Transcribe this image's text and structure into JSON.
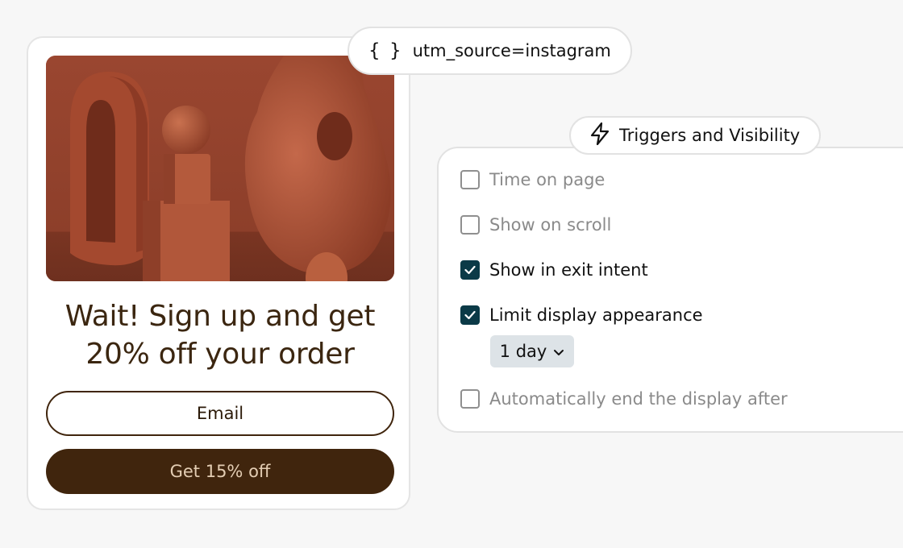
{
  "popup": {
    "headline": "Wait! Sign up and get 20% off your order",
    "email_placeholder": "Email",
    "cta_label": "Get 15% off"
  },
  "utm_chip": {
    "icon": "braces-icon",
    "label": "utm_source=instagram"
  },
  "triggers": {
    "title": "Triggers and Visibility",
    "icon": "lightning-icon",
    "options": [
      {
        "label": "Time on page",
        "checked": false
      },
      {
        "label": "Show on scroll",
        "checked": false
      },
      {
        "label": "Show in exit intent",
        "checked": true
      },
      {
        "label": "Limit display appearance",
        "checked": true
      },
      {
        "label": "Automatically end the display after",
        "checked": false
      }
    ],
    "limit_duration": "1 day"
  },
  "colors": {
    "brand_brown": "#40250d",
    "cta_text": "#e3cdb3",
    "checkbox_checked": "#0b3a47",
    "select_bg": "#dde3e7"
  }
}
